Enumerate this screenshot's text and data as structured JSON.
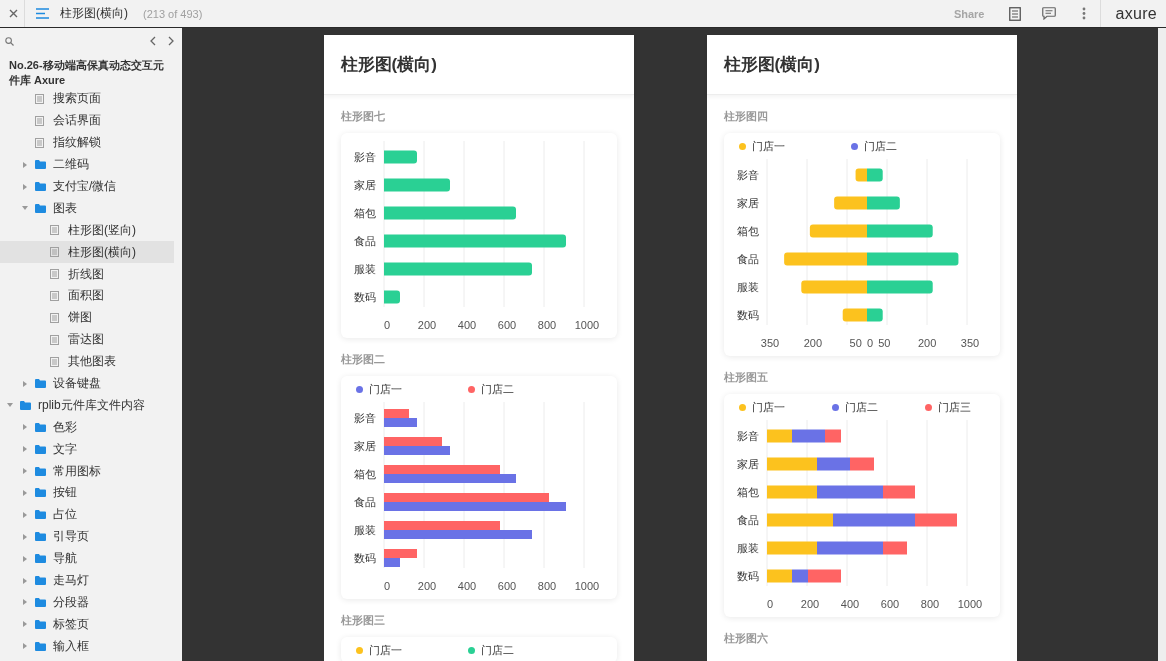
{
  "toolbar": {
    "page_title": "柱形图(横向)",
    "page_count": "(213 of 493)",
    "share": "Share",
    "logo": "axure"
  },
  "sidebar": {
    "project": "No.26-移动端高保真动态交互元件库 Axure",
    "tree": [
      {
        "children": [
          {
            "label": "搜索页面",
            "kind": "page",
            "selected": false
          },
          {
            "label": "会话界面",
            "kind": "page",
            "selected": false
          },
          {
            "label": "指纹解锁",
            "kind": "page",
            "selected": false
          },
          {
            "label": "二维码",
            "kind": "folder",
            "expanded": false,
            "selected": false
          },
          {
            "label": "支付宝/微信",
            "kind": "folder",
            "expanded": false,
            "selected": false
          },
          {
            "label": "图表",
            "kind": "folder",
            "expanded": true,
            "selected": false,
            "children": [
              {
                "label": "柱形图(竖向)",
                "kind": "page",
                "selected": false
              },
              {
                "label": "柱形图(横向)",
                "kind": "page",
                "selected": true
              },
              {
                "label": "折线图",
                "kind": "page",
                "selected": false
              },
              {
                "label": "面积图",
                "kind": "page",
                "selected": false
              },
              {
                "label": "饼图",
                "kind": "page",
                "selected": false
              },
              {
                "label": "雷达图",
                "kind": "page",
                "selected": false
              },
              {
                "label": "其他图表",
                "kind": "page",
                "selected": false
              }
            ]
          },
          {
            "label": "设备键盘",
            "kind": "folder",
            "expanded": false,
            "selected": false
          }
        ]
      },
      {
        "label": "rplib元件库文件内容",
        "kind": "folder",
        "expanded": true,
        "selected": false,
        "children": [
          {
            "label": "色彩",
            "kind": "folder",
            "expanded": false,
            "selected": false
          },
          {
            "label": "文字",
            "kind": "folder",
            "expanded": false,
            "selected": false
          },
          {
            "label": "常用图标",
            "kind": "folder",
            "expanded": false,
            "selected": false
          },
          {
            "label": "按钮",
            "kind": "folder",
            "expanded": false,
            "selected": false
          },
          {
            "label": "占位",
            "kind": "folder",
            "expanded": false,
            "selected": false
          },
          {
            "label": "引导页",
            "kind": "folder",
            "expanded": false,
            "selected": false
          },
          {
            "label": "导航",
            "kind": "folder",
            "expanded": false,
            "selected": false
          },
          {
            "label": "走马灯",
            "kind": "folder",
            "expanded": false,
            "selected": false
          },
          {
            "label": "分段器",
            "kind": "folder",
            "expanded": false,
            "selected": false
          },
          {
            "label": "标签页",
            "kind": "folder",
            "expanded": false,
            "selected": false
          },
          {
            "label": "输入框",
            "kind": "folder",
            "expanded": false,
            "selected": false
          }
        ]
      }
    ]
  },
  "cards": [
    {
      "title": "柱形图(横向)",
      "sections": [
        {
          "title": "柱形图七",
          "chart_data": {
            "type": "bar",
            "orientation": "horizontal",
            "grid": true,
            "categories": [
              "影音",
              "家居",
              "箱包",
              "食品",
              "服装",
              "数码"
            ],
            "series": [
              {
                "color": "#2ad094",
                "values": [
                  165,
                  330,
                  660,
                  910,
                  740,
                  80
                ]
              }
            ],
            "xlim": [
              0,
              1000
            ],
            "xticks": [
              0,
              200,
              400,
              600,
              800,
              1000
            ]
          }
        },
        {
          "title": "柱形图二",
          "legend": [
            {
              "label": "门店一",
              "color": "#6a72e6"
            },
            {
              "label": "门店二",
              "color": "#ff6464"
            }
          ],
          "chart_data": {
            "type": "bar",
            "orientation": "horizontal",
            "grid": true,
            "categories": [
              "影音",
              "家居",
              "箱包",
              "食品",
              "服装",
              "数码"
            ],
            "series": [
              {
                "color": "#6a72e6",
                "values": [
                  165,
                  330,
                  660,
                  910,
                  740,
                  80
                ]
              },
              {
                "color": "#ff6464",
                "values": [
                  125,
                  290,
                  580,
                  825,
                  580,
                  165
                ]
              }
            ],
            "xlim": [
              0,
              1000
            ],
            "xticks": [
              0,
              200,
              400,
              600,
              800,
              1000
            ]
          }
        },
        {
          "title": "柱形图三",
          "legend": [
            {
              "label": "门店一",
              "color": "#fcc21e"
            },
            {
              "label": "门店二",
              "color": "#2ad094"
            }
          ]
        }
      ]
    },
    {
      "title": "柱形图(横向)",
      "sections": [
        {
          "title": "柱形图四",
          "legend": [
            {
              "label": "门店一",
              "color": "#fcc21e"
            },
            {
              "label": "门店二",
              "color": "#6a72e6"
            }
          ],
          "chart_data": {
            "type": "bar",
            "orientation": "horizontal",
            "grid": true,
            "stacked": true,
            "categories": [
              "影音",
              "家居",
              "箱包",
              "食品",
              "服装",
              "数码"
            ],
            "series": [
              {
                "color": "#fcc21e",
                "values": [
                  -40,
                  -115,
                  -200,
                  -290,
                  -230,
                  -85
                ]
              },
              {
                "color": "#2ad094",
                "values": [
                  55,
                  115,
                  230,
                  320,
                  230,
                  55
                ]
              }
            ],
            "xlim": [
              -350,
              350
            ],
            "xticks": [
              {
                "value": -350,
                "label": "350"
              },
              {
                "value": -200,
                "label": "200"
              },
              {
                "value": -50,
                "label": "50"
              },
              0,
              50,
              200,
              350
            ]
          }
        },
        {
          "title": "柱形图五",
          "legend": [
            {
              "label": "门店一",
              "color": "#fcc21e"
            },
            {
              "label": "门店二",
              "color": "#6a72e6"
            },
            {
              "label": "门店三",
              "color": "#ff6464"
            }
          ],
          "chart_data": {
            "type": "bar",
            "orientation": "horizontal",
            "grid": true,
            "stacked": true,
            "categories": [
              "影音",
              "家居",
              "箱包",
              "食品",
              "服装",
              "数码"
            ],
            "series": [
              {
                "color": "#fcc21e",
                "values": [
                  125,
                  250,
                  250,
                  330,
                  250,
                  125
                ]
              },
              {
                "color": "#6a72e6",
                "values": [
                  165,
                  165,
                  330,
                  410,
                  330,
                  80
                ]
              },
              {
                "color": "#ff6464",
                "values": [
                  80,
                  120,
                  160,
                  210,
                  120,
                  165
                ]
              }
            ],
            "xlim": [
              0,
              1000
            ],
            "xticks": [
              0,
              200,
              400,
              600,
              800,
              1000
            ]
          }
        },
        {
          "title": "柱形图六"
        }
      ]
    }
  ]
}
